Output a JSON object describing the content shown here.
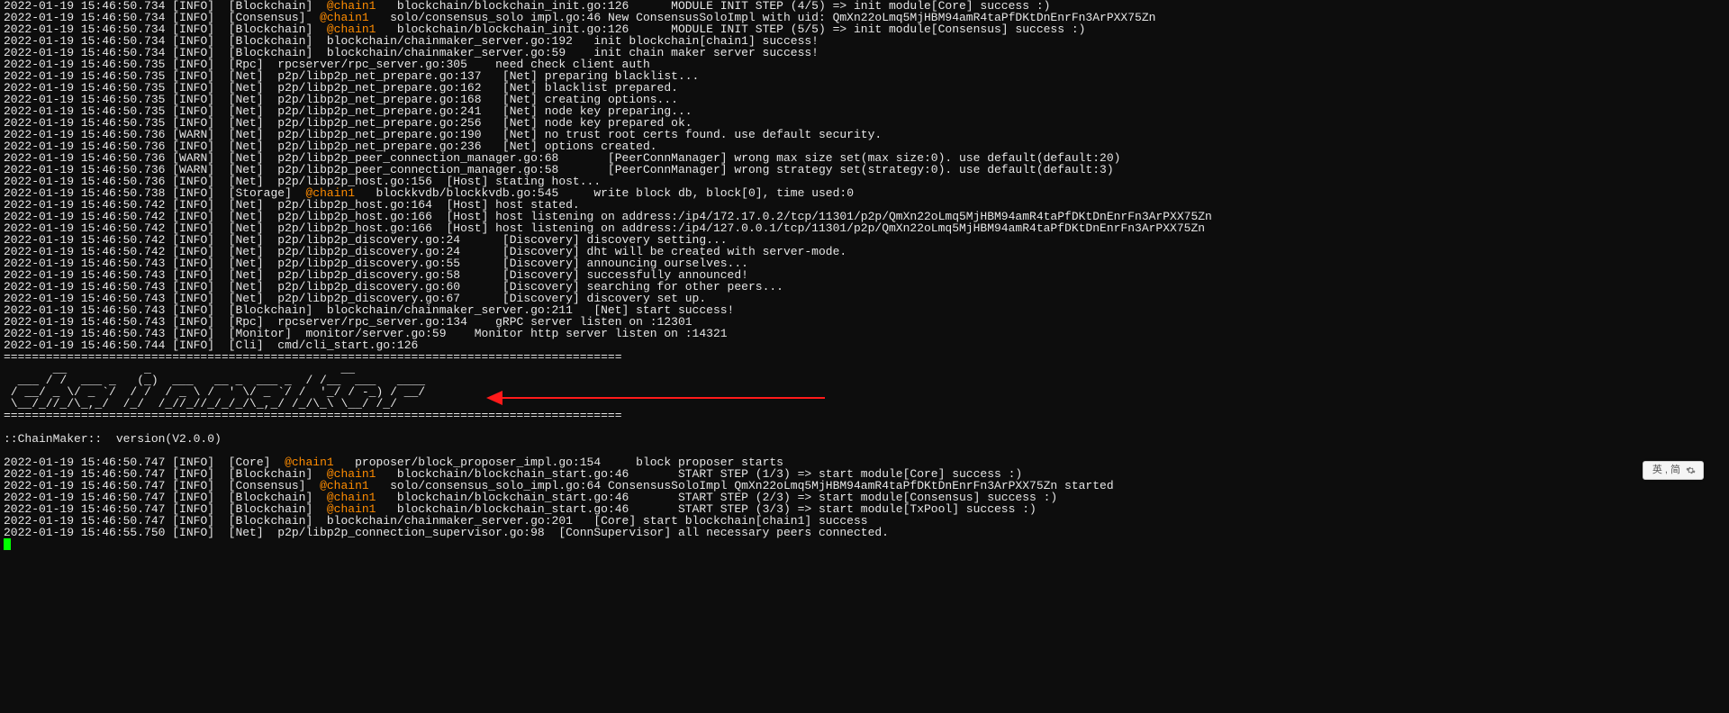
{
  "logs": [
    {
      "ts": "2022-01-19 15:46:50.734",
      "lvl": "INFO",
      "mod": "Blockchain",
      "chain": "@chain1",
      "path": "blockchain/blockchain_init.go:126",
      "msg": "      MODULE INIT STEP (4/5) => init module[Core] success :)"
    },
    {
      "ts": "2022-01-19 15:46:50.734",
      "lvl": "INFO",
      "mod": "Consensus",
      "chain": "@chain1",
      "path": "solo/consensus_solo impl.go:46",
      "msg": " New ConsensusSoloImpl with uid: QmXn22oLmq5MjHBM94amR4taPfDKtDnEnrFn3ArPXX75Zn"
    },
    {
      "ts": "2022-01-19 15:46:50.734",
      "lvl": "INFO",
      "mod": "Blockchain",
      "chain": "@chain1",
      "path": "blockchain/blockchain_init.go:126",
      "msg": "      MODULE INIT STEP (5/5) => init module[Consensus] success :)"
    },
    {
      "ts": "2022-01-19 15:46:50.734",
      "lvl": "INFO",
      "mod": "Blockchain",
      "chain": "",
      "path": "blockchain/chainmaker_server.go:192",
      "msg": "   init blockchain[chain1] success!"
    },
    {
      "ts": "2022-01-19 15:46:50.734",
      "lvl": "INFO",
      "mod": "Blockchain",
      "chain": "",
      "path": "blockchain/chainmaker_server.go:59",
      "msg": "    init chain maker server success!"
    },
    {
      "ts": "2022-01-19 15:46:50.735",
      "lvl": "INFO",
      "mod": "Rpc",
      "chain": "",
      "path": "rpcserver/rpc_server.go:305",
      "msg": "    need check client auth"
    },
    {
      "ts": "2022-01-19 15:46:50.735",
      "lvl": "INFO",
      "mod": "Net",
      "chain": "",
      "path": "p2p/libp2p_net_prepare.go:137",
      "msg": "   [Net] preparing blacklist..."
    },
    {
      "ts": "2022-01-19 15:46:50.735",
      "lvl": "INFO",
      "mod": "Net",
      "chain": "",
      "path": "p2p/libp2p_net_prepare.go:162",
      "msg": "   [Net] blacklist prepared."
    },
    {
      "ts": "2022-01-19 15:46:50.735",
      "lvl": "INFO",
      "mod": "Net",
      "chain": "",
      "path": "p2p/libp2p_net_prepare.go:168",
      "msg": "   [Net] creating options..."
    },
    {
      "ts": "2022-01-19 15:46:50.735",
      "lvl": "INFO",
      "mod": "Net",
      "chain": "",
      "path": "p2p/libp2p_net_prepare.go:241",
      "msg": "   [Net] node key preparing..."
    },
    {
      "ts": "2022-01-19 15:46:50.735",
      "lvl": "INFO",
      "mod": "Net",
      "chain": "",
      "path": "p2p/libp2p_net_prepare.go:256",
      "msg": "   [Net] node key prepared ok."
    },
    {
      "ts": "2022-01-19 15:46:50.736",
      "lvl": "WARN",
      "mod": "Net",
      "chain": "",
      "path": "p2p/libp2p_net_prepare.go:190",
      "msg": "   [Net] no trust root certs found. use default security."
    },
    {
      "ts": "2022-01-19 15:46:50.736",
      "lvl": "INFO",
      "mod": "Net",
      "chain": "",
      "path": "p2p/libp2p_net_prepare.go:236",
      "msg": "   [Net] options created."
    },
    {
      "ts": "2022-01-19 15:46:50.736",
      "lvl": "WARN",
      "mod": "Net",
      "chain": "",
      "path": "p2p/libp2p_peer_connection_manager.go:68",
      "msg": "       [PeerConnManager] wrong max size set(max size:0). use default(default:20)"
    },
    {
      "ts": "2022-01-19 15:46:50.736",
      "lvl": "WARN",
      "mod": "Net",
      "chain": "",
      "path": "p2p/libp2p_peer_connection_manager.go:58",
      "msg": "       [PeerConnManager] wrong strategy set(strategy:0). use default(default:3)"
    },
    {
      "ts": "2022-01-19 15:46:50.736",
      "lvl": "INFO",
      "mod": "Net",
      "chain": "",
      "path": "p2p/libp2p_host.go:156",
      "msg": "  [Host] stating host..."
    },
    {
      "ts": "2022-01-19 15:46:50.738",
      "lvl": "INFO",
      "mod": "Storage",
      "chain": "@chain1",
      "path": "blockkvdb/blockkvdb.go:545",
      "msg": "     write block db, block[0], time used:0"
    },
    {
      "ts": "2022-01-19 15:46:50.742",
      "lvl": "INFO",
      "mod": "Net",
      "chain": "",
      "path": "p2p/libp2p_host.go:164",
      "msg": "  [Host] host stated."
    },
    {
      "ts": "2022-01-19 15:46:50.742",
      "lvl": "INFO",
      "mod": "Net",
      "chain": "",
      "path": "p2p/libp2p_host.go:166",
      "msg": "  [Host] host listening on address:/ip4/172.17.0.2/tcp/11301/p2p/QmXn22oLmq5MjHBM94amR4taPfDKtDnEnrFn3ArPXX75Zn"
    },
    {
      "ts": "2022-01-19 15:46:50.742",
      "lvl": "INFO",
      "mod": "Net",
      "chain": "",
      "path": "p2p/libp2p_host.go:166",
      "msg": "  [Host] host listening on address:/ip4/127.0.0.1/tcp/11301/p2p/QmXn22oLmq5MjHBM94amR4taPfDKtDnEnrFn3ArPXX75Zn"
    },
    {
      "ts": "2022-01-19 15:46:50.742",
      "lvl": "INFO",
      "mod": "Net",
      "chain": "",
      "path": "p2p/libp2p_discovery.go:24",
      "msg": "      [Discovery] discovery setting..."
    },
    {
      "ts": "2022-01-19 15:46:50.742",
      "lvl": "INFO",
      "mod": "Net",
      "chain": "",
      "path": "p2p/libp2p_discovery.go:24",
      "msg": "      [Discovery] dht will be created with server-mode."
    },
    {
      "ts": "2022-01-19 15:46:50.743",
      "lvl": "INFO",
      "mod": "Net",
      "chain": "",
      "path": "p2p/libp2p_discovery.go:55",
      "msg": "      [Discovery] announcing ourselves..."
    },
    {
      "ts": "2022-01-19 15:46:50.743",
      "lvl": "INFO",
      "mod": "Net",
      "chain": "",
      "path": "p2p/libp2p_discovery.go:58",
      "msg": "      [Discovery] successfully announced!"
    },
    {
      "ts": "2022-01-19 15:46:50.743",
      "lvl": "INFO",
      "mod": "Net",
      "chain": "",
      "path": "p2p/libp2p_discovery.go:60",
      "msg": "      [Discovery] searching for other peers..."
    },
    {
      "ts": "2022-01-19 15:46:50.743",
      "lvl": "INFO",
      "mod": "Net",
      "chain": "",
      "path": "p2p/libp2p_discovery.go:67",
      "msg": "      [Discovery] discovery set up."
    },
    {
      "ts": "2022-01-19 15:46:50.743",
      "lvl": "INFO",
      "mod": "Blockchain",
      "chain": "",
      "path": "blockchain/chainmaker_server.go:211",
      "msg": "   [Net] start success!"
    },
    {
      "ts": "2022-01-19 15:46:50.743",
      "lvl": "INFO",
      "mod": "Rpc",
      "chain": "",
      "path": "rpcserver/rpc_server.go:134",
      "msg": "    gRPC server listen on :12301"
    },
    {
      "ts": "2022-01-19 15:46:50.743",
      "lvl": "INFO",
      "mod": "Monitor",
      "chain": "",
      "path": "monitor/server.go:59",
      "msg": "    Monitor http server listen on :14321"
    },
    {
      "ts": "2022-01-19 15:46:50.744",
      "lvl": "INFO",
      "mod": "Cli",
      "chain": "",
      "path": "cmd/cli_start.go:126",
      "msg": ""
    }
  ],
  "banner": {
    "sep": "========================================================================================",
    "ascii": [
      "       __           _                           __                  ",
      "  ___ / /  ___ _   (_)  ___   __ _  ___ _  / /__  ___   ____     ",
      " / __/ _ \\/ _ `/  / /  / _ \\ /  ' \\/ _ `/ /  '_/ / -_) / __/     ",
      " \\__/_//_/\\_,_/  /_/  /_//_//_/_/_/\\_,_/ /_/\\_\\ \\__/ /_/         "
    ],
    "tagline": "::ChainMaker::  version(V2.0.0)"
  },
  "logs2": [
    {
      "ts": "2022-01-19 15:46:50.747",
      "lvl": "INFO",
      "mod": "Core",
      "chain": "@chain1",
      "path": "proposer/block_proposer_impl.go:154",
      "msg": "     block proposer starts"
    },
    {
      "ts": "2022-01-19 15:46:50.747",
      "lvl": "INFO",
      "mod": "Blockchain",
      "chain": "@chain1",
      "path": "blockchain/blockchain_start.go:46",
      "msg": "       START STEP (1/3) => start module[Core] success :)"
    },
    {
      "ts": "2022-01-19 15:46:50.747",
      "lvl": "INFO",
      "mod": "Consensus",
      "chain": "@chain1",
      "path": "solo/consensus_solo_impl.go:64",
      "msg": " ConsensusSoloImpl QmXn22oLmq5MjHBM94amR4taPfDKtDnEnrFn3ArPXX75Zn started"
    },
    {
      "ts": "2022-01-19 15:46:50.747",
      "lvl": "INFO",
      "mod": "Blockchain",
      "chain": "@chain1",
      "path": "blockchain/blockchain_start.go:46",
      "msg": "       START STEP (2/3) => start module[Consensus] success :)"
    },
    {
      "ts": "2022-01-19 15:46:50.747",
      "lvl": "INFO",
      "mod": "Blockchain",
      "chain": "@chain1",
      "path": "blockchain/blockchain_start.go:46",
      "msg": "       START STEP (3/3) => start module[TxPool] success :)"
    },
    {
      "ts": "2022-01-19 15:46:50.747",
      "lvl": "INFO",
      "mod": "Blockchain",
      "chain": "",
      "path": "blockchain/chainmaker_server.go:201",
      "msg": "   [Core] start blockchain[chain1] success"
    },
    {
      "ts": "2022-01-19 15:46:55.750",
      "lvl": "INFO",
      "mod": "Net",
      "chain": "",
      "path": "p2p/libp2p_connection_supervisor.go:98",
      "msg": "  [ConnSupervisor] all necessary peers connected."
    }
  ],
  "ime": {
    "label": "英 , 简"
  },
  "annotation": {
    "arrow_target": "chainmaker-ascii-banner"
  }
}
